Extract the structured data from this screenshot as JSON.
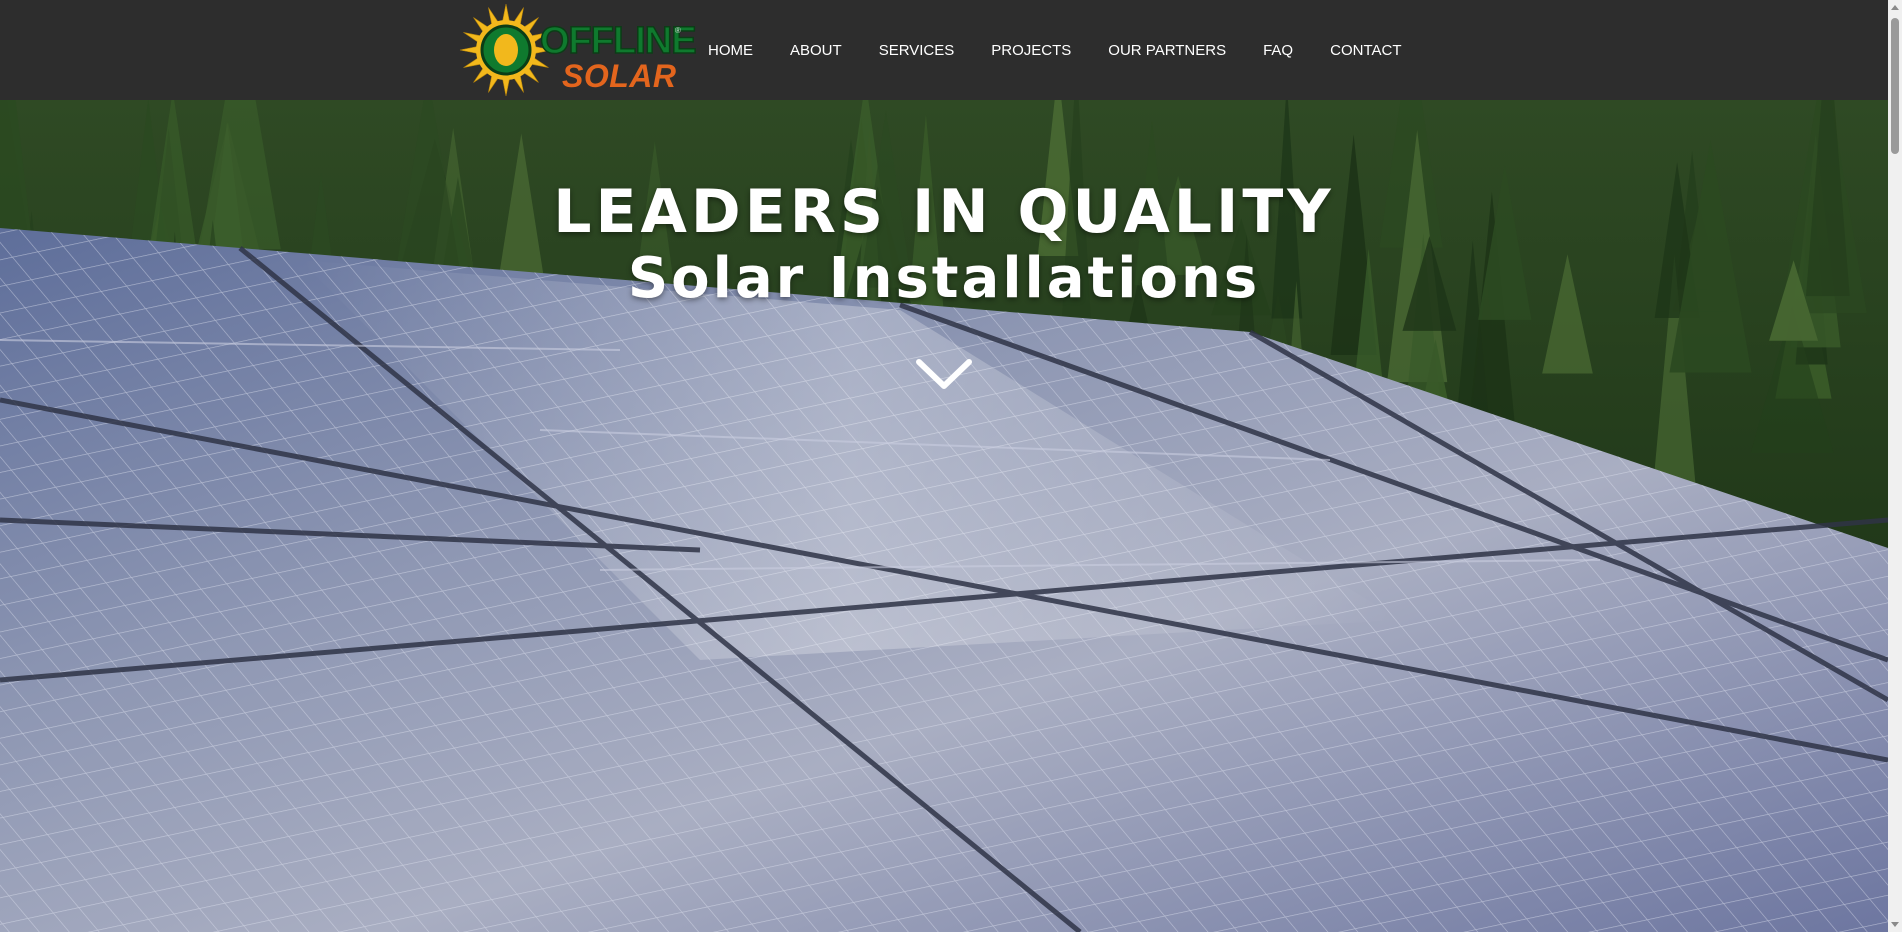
{
  "brand": {
    "logo_word1": "OFFLINE",
    "logo_word2": "SOLAR",
    "logo_trademark": "®",
    "green": "#0f7a2e",
    "orange": "#e3651d",
    "sun_yellow": "#f2b81c"
  },
  "nav": {
    "items": [
      {
        "label": "HOME"
      },
      {
        "label": "ABOUT"
      },
      {
        "label": "SERVICES"
      },
      {
        "label": "PROJECTS"
      },
      {
        "label": "OUR PARTNERS"
      },
      {
        "label": "FAQ"
      },
      {
        "label": "CONTACT"
      }
    ]
  },
  "hero": {
    "headline_line1": "LEADERS IN QUALITY",
    "headline_line2": "Solar Installations",
    "scroll_icon": "chevron-down-icon",
    "background": "solar panels on roof with pine forest behind"
  },
  "colors": {
    "header_bg": "#2d2d2d",
    "nav_text": "#ffffff"
  }
}
